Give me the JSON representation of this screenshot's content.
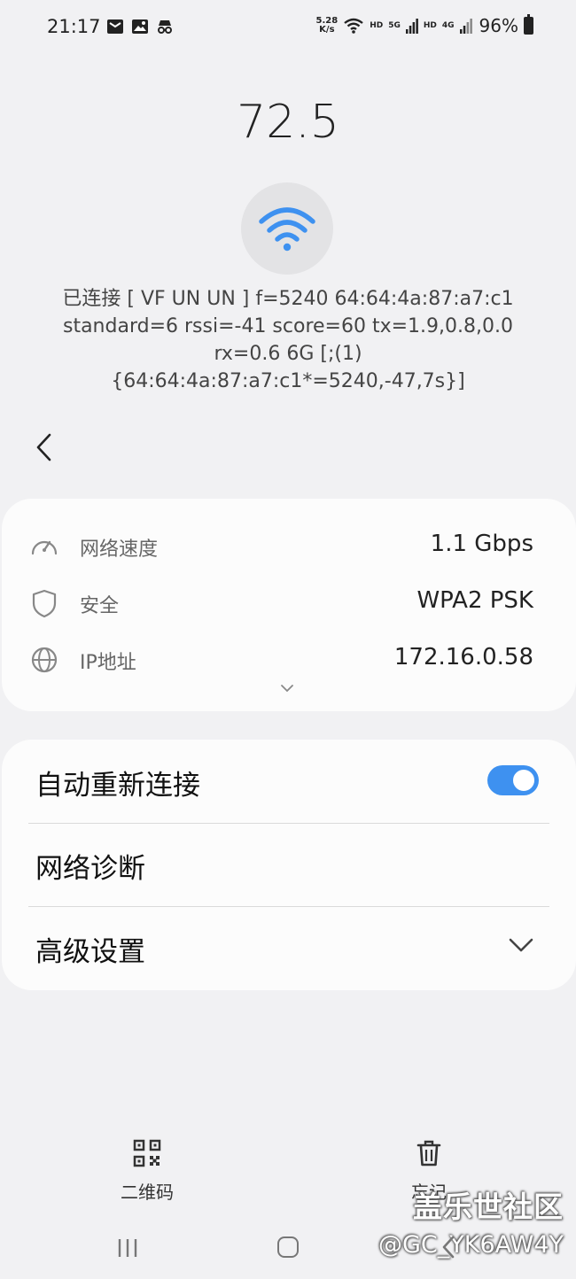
{
  "status_bar": {
    "time": "21:17",
    "network_speed_value": "5.28",
    "network_speed_unit": "K/s",
    "hd1": "HD",
    "net1": "5G",
    "hd2": "HD",
    "net2": "4G",
    "battery_percent": "96%",
    "icons_left": [
      "mail-icon",
      "image-icon",
      "incognito-icon"
    ],
    "icons_right": [
      "wifi-icon",
      "signal-icon",
      "signal-icon",
      "battery-icon"
    ]
  },
  "header": {
    "speed_value": "72.5",
    "diag_lines": [
      "已连接 [ VF UN UN ]  f=5240  64:64:4a:87:a7:c1",
      "standard=6 rssi=-41  score=60 tx=1.9,0.8,0.0",
      "rx=0.6 6G [;(1)",
      "{64:64:4a:87:a7:c1*=5240,-47,7s}]"
    ]
  },
  "info": {
    "items": [
      {
        "label": "网络速度",
        "value": "1.1 Gbps",
        "icon": "speedometer-icon"
      },
      {
        "label": "安全",
        "value": "WPA2 PSK",
        "icon": "shield-icon"
      },
      {
        "label": "IP地址",
        "value": "172.16.0.58",
        "icon": "globe-icon"
      }
    ]
  },
  "settings": {
    "auto_reconnect_label": "自动重新连接",
    "auto_reconnect_on": true,
    "diagnostics_label": "网络诊断",
    "advanced_label": "高级设置"
  },
  "bottom": {
    "qr_label": "二维码",
    "forget_label": "忘记"
  },
  "watermark": {
    "line1": "盖乐世社区",
    "line2": "@GC_YK6AW4Y"
  },
  "colors": {
    "accent": "#3e91f0",
    "background": "#f1f1f3",
    "card": "#fcfcfc"
  }
}
